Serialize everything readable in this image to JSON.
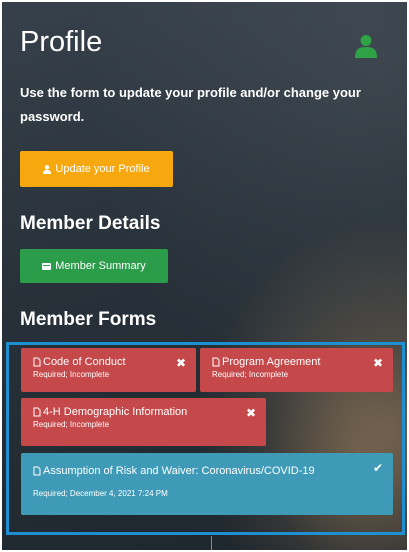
{
  "header": {
    "title": "Profile",
    "icon": "user-icon",
    "icon_color": "#2ea446"
  },
  "intro": {
    "text": "Use the form to update your profile and/or change your password."
  },
  "buttons": {
    "update_profile": {
      "label": "Update your Profile",
      "icon": "user-icon",
      "color": "#f7a80e"
    },
    "member_summary": {
      "label": "Member Summary",
      "icon": "card-icon",
      "color": "#2b9c4a"
    }
  },
  "sections": {
    "member_details": "Member Details",
    "member_forms": "Member Forms"
  },
  "forms": [
    {
      "title": "Code of Conduct",
      "status": "Required; Incomplete",
      "state": "incomplete",
      "color": "#c5484a",
      "mark": "✖"
    },
    {
      "title": "Program Agreement",
      "status": "Required; Incomplete",
      "state": "incomplete",
      "color": "#c5484a",
      "mark": "✖"
    },
    {
      "title": "4-H Demographic Information",
      "status": "Required; Incomplete",
      "state": "incomplete",
      "color": "#c5484a",
      "mark": "✖"
    },
    {
      "title": "Assumption of Risk and Waiver: Coronavirus/COVID-19",
      "status": "Required; December 4, 2021 7:24 PM",
      "state": "complete",
      "color": "#3f9ab8",
      "mark": "✔"
    }
  ],
  "highlight_color": "#1e8fd1"
}
